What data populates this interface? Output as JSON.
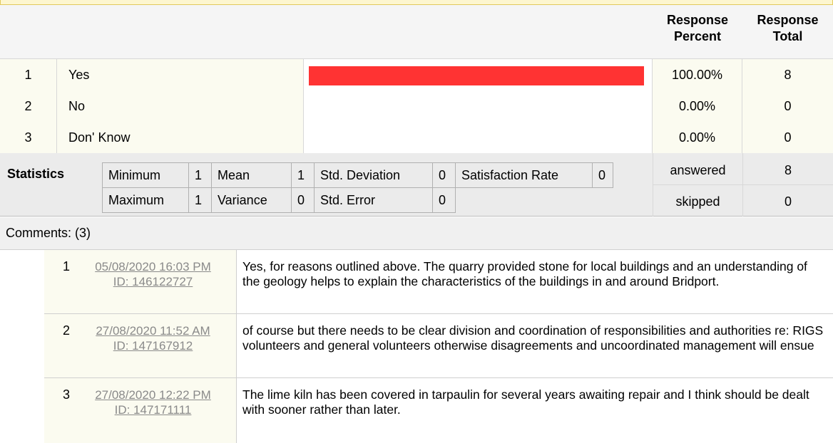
{
  "header": {
    "percent_label_1": "Response",
    "percent_label_2": "Percent",
    "total_label_1": "Response",
    "total_label_2": "Total"
  },
  "answers": [
    {
      "num": "1",
      "label": "Yes",
      "percent": "100.00%",
      "total": "8",
      "fraction": 1.0
    },
    {
      "num": "2",
      "label": "No",
      "percent": "0.00%",
      "total": "0",
      "fraction": 0.0
    },
    {
      "num": "3",
      "label": "Don' Know",
      "percent": "0.00%",
      "total": "0",
      "fraction": 0.0
    }
  ],
  "bar_color": "#ff3333",
  "statistics": {
    "title": "Statistics",
    "minimum_label": "Minimum",
    "minimum": "1",
    "mean_label": "Mean",
    "mean": "1",
    "std_dev_label": "Std. Deviation",
    "std_dev": "0",
    "sat_label": "Satisfaction Rate",
    "sat": "0",
    "maximum_label": "Maximum",
    "maximum": "1",
    "variance_label": "Variance",
    "variance": "0",
    "std_err_label": "Std. Error",
    "std_err": "0"
  },
  "summary": {
    "answered_label": "answered",
    "answered": "8",
    "skipped_label": "skipped",
    "skipped": "0"
  },
  "comments": {
    "header": "Comments: (3)",
    "items": [
      {
        "num": "1",
        "date": "05/08/2020 16:03 PM",
        "id": "ID: 146122727",
        "text": "Yes, for reasons outlined above. The quarry provided stone for local buildings and an understanding of the geology helps to explain the characteristics of the buildings in and around Bridport."
      },
      {
        "num": "2",
        "date": "27/08/2020 11:52 AM",
        "id": "ID: 147167912",
        "text": "of course but there needs to be clear division and coordination of responsibilities and authorities re: RIGS volunteers and general volunteers otherwise disagreements and uncoordinated management will ensue"
      },
      {
        "num": "3",
        "date": "27/08/2020 12:22 PM",
        "id": "ID: 147171111",
        "text": "The lime kiln has been covered in tarpaulin for several years awaiting repair and I think should be dealt with sooner rather than later."
      }
    ]
  }
}
